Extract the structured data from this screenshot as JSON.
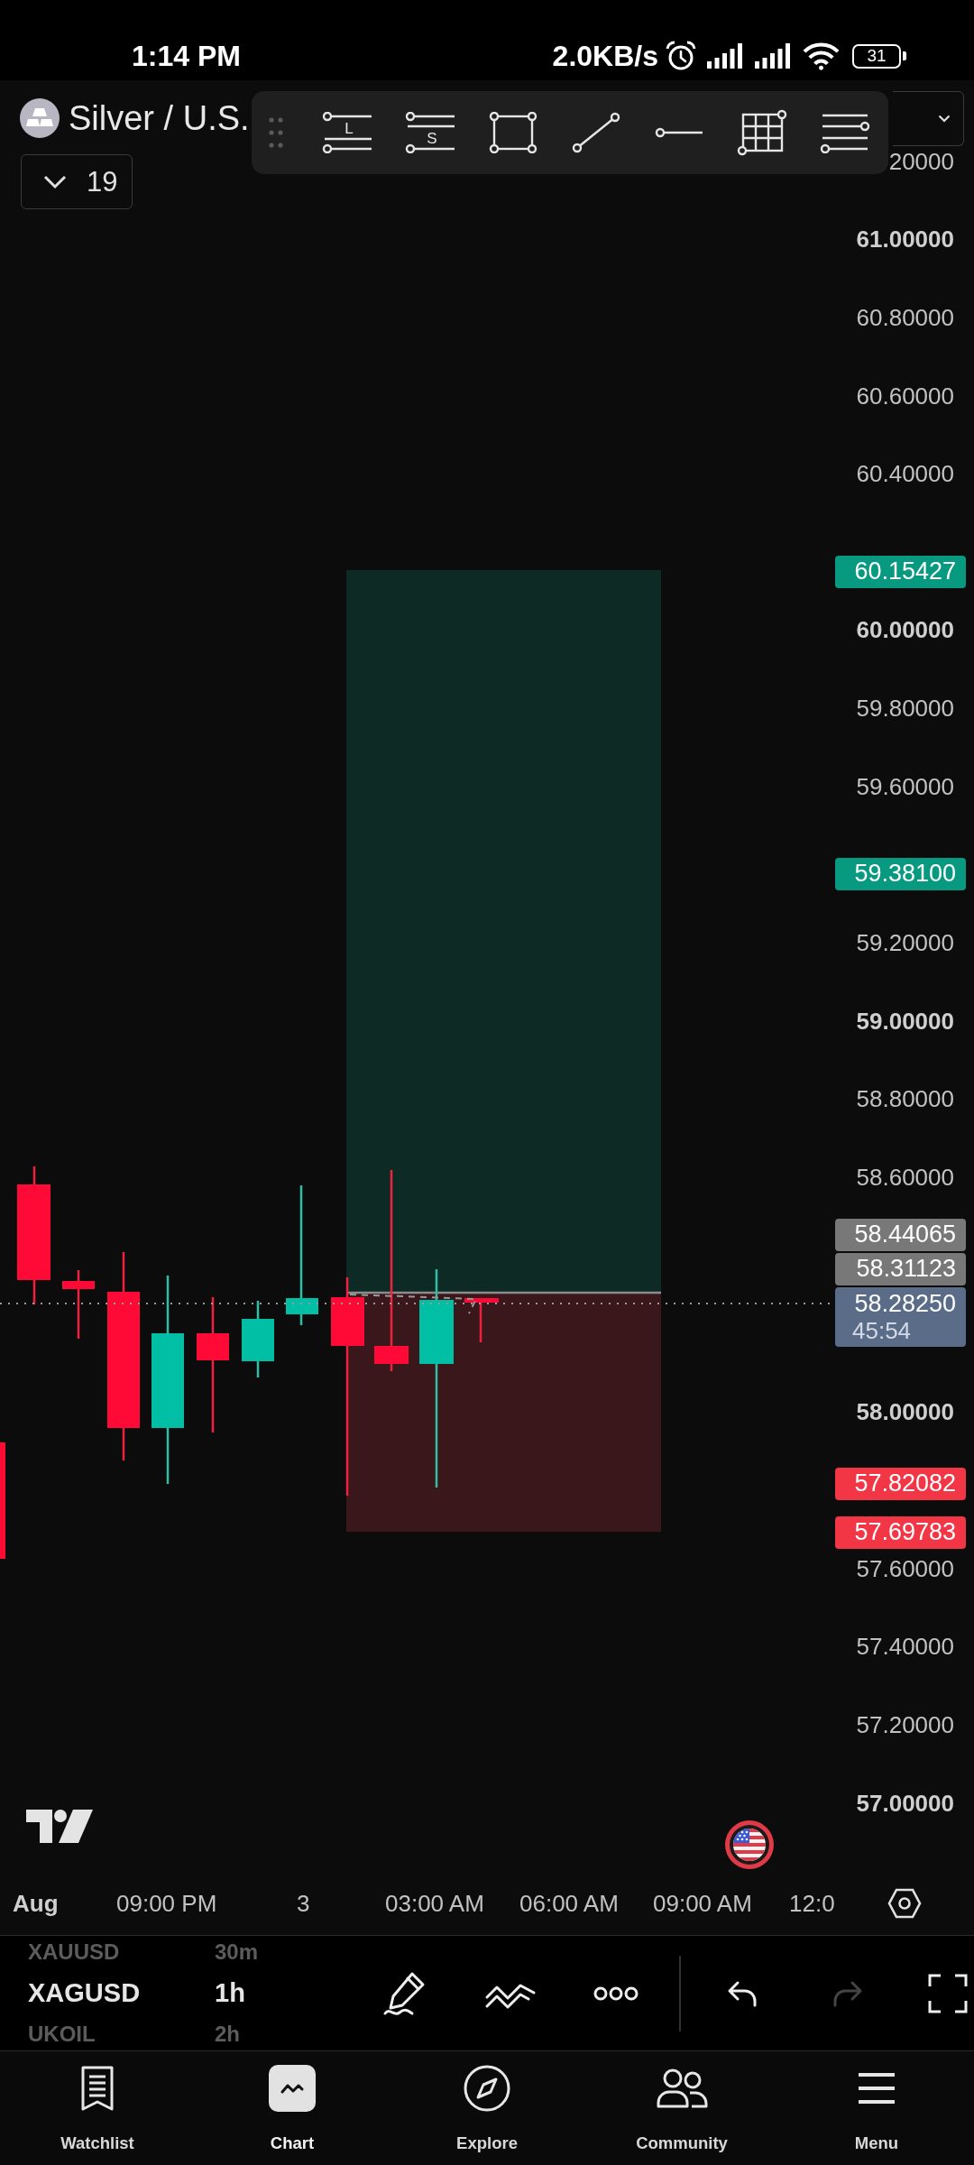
{
  "status_bar": {
    "time": "1:14 PM",
    "network_speed": "2.0KB/s",
    "battery": "31"
  },
  "header": {
    "symbol": "Silver / U.S.",
    "legend_count": "19"
  },
  "drawing_toolbar": {
    "tools": [
      {
        "kind": "long-position",
        "letter": "L"
      },
      {
        "kind": "short-position",
        "letter": "S"
      },
      {
        "kind": "rectangle"
      },
      {
        "kind": "trend-line"
      },
      {
        "kind": "horizontal-ray"
      },
      {
        "kind": "grid"
      },
      {
        "kind": "parallel-lines"
      }
    ]
  },
  "price_axis": {
    "ticks": [
      {
        "label": "20000",
        "kind": "minor"
      },
      {
        "label": "61.00000",
        "kind": "major"
      },
      {
        "label": "60.80000",
        "kind": "minor"
      },
      {
        "label": "60.60000",
        "kind": "minor"
      },
      {
        "label": "60.40000",
        "kind": "minor"
      },
      {
        "label": "60.00000",
        "kind": "major"
      },
      {
        "label": "59.80000",
        "kind": "minor"
      },
      {
        "label": "59.60000",
        "kind": "minor"
      },
      {
        "label": "59.20000",
        "kind": "minor"
      },
      {
        "label": "59.00000",
        "kind": "major"
      },
      {
        "label": "58.80000",
        "kind": "minor"
      },
      {
        "label": "58.60000",
        "kind": "minor"
      },
      {
        "label": "58.00000",
        "kind": "major"
      },
      {
        "label": "57.60000",
        "kind": "minor"
      },
      {
        "label": "57.40000",
        "kind": "minor"
      },
      {
        "label": "57.20000",
        "kind": "minor"
      },
      {
        "label": "57.00000",
        "kind": "major"
      }
    ],
    "badges": [
      {
        "price": "60.15427",
        "color": "#089981"
      },
      {
        "price": "59.38100",
        "color": "#089981"
      },
      {
        "price": "58.44065",
        "color": "#787878"
      },
      {
        "price": "58.31123",
        "color": "#787878"
      },
      {
        "price": "58.28250",
        "countdown": "45:54",
        "color": "#5b6c88"
      },
      {
        "price": "57.82082",
        "color": "#f23645"
      },
      {
        "price": "57.69783",
        "color": "#f23645"
      }
    ]
  },
  "time_axis": {
    "labels": [
      {
        "label": "Aug",
        "kind": "major"
      },
      {
        "label": "09:00 PM",
        "kind": "minor"
      },
      {
        "label": "3",
        "kind": "minor"
      },
      {
        "label": "03:00 AM",
        "kind": "minor"
      },
      {
        "label": "06:00 AM",
        "kind": "minor"
      },
      {
        "label": "09:00 AM",
        "kind": "minor"
      },
      {
        "label": "12:0",
        "kind": "minor"
      }
    ]
  },
  "symbol_picker": {
    "items": [
      {
        "symbol": "XAUUSD",
        "interval": "30m",
        "selected": false
      },
      {
        "symbol": "XAGUSD",
        "interval": "1h",
        "selected": true
      },
      {
        "symbol": "UKOIL",
        "interval": "2h",
        "selected": false
      }
    ]
  },
  "chart_toolbar": {
    "buttons": [
      {
        "kind": "draw",
        "disabled": false
      },
      {
        "kind": "indicators",
        "disabled": false
      },
      {
        "kind": "more",
        "disabled": false
      },
      {
        "kind": "undo",
        "disabled": false
      },
      {
        "kind": "redo",
        "disabled": true
      },
      {
        "kind": "fullscreen",
        "disabled": false
      }
    ]
  },
  "bottom_nav": {
    "items": [
      {
        "label": "Watchlist",
        "selected": false
      },
      {
        "label": "Chart",
        "selected": true
      },
      {
        "label": "Explore",
        "selected": false
      },
      {
        "label": "Community",
        "selected": false
      },
      {
        "label": "Menu",
        "selected": false
      }
    ]
  }
}
